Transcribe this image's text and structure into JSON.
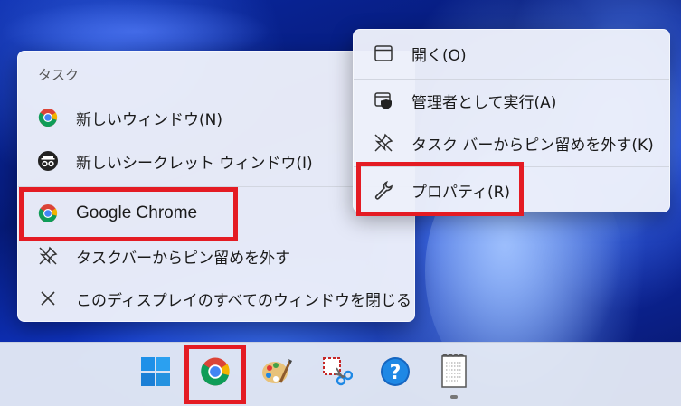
{
  "jump_list": {
    "header": "タスク",
    "items": [
      {
        "label": "新しいウィンドウ(N)",
        "icon": "chrome-icon"
      },
      {
        "label": "新しいシークレット ウィンドウ(I)",
        "icon": "incognito-icon"
      },
      {
        "label": "Google Chrome",
        "icon": "chrome-icon"
      },
      {
        "label": "タスクバーからピン留めを外す",
        "icon": "unpin-icon"
      },
      {
        "label": "このディスプレイのすべてのウィンドウを閉じる",
        "icon": "close-icon"
      }
    ]
  },
  "context_menu": {
    "items": [
      {
        "label": "開く(O)",
        "icon": "window-icon"
      },
      {
        "label": "管理者として実行(A)",
        "icon": "shield-icon"
      },
      {
        "label": "タスク バーからピン留めを外す(K)",
        "icon": "unpin-icon"
      },
      {
        "label": "プロパティ(R)",
        "icon": "wrench-icon"
      }
    ]
  },
  "taskbar": {
    "items": [
      "windows-start-icon",
      "chrome-icon",
      "paint-icon",
      "snipping-tool-icon",
      "help-icon",
      "notepad-icon"
    ]
  },
  "colors": {
    "highlight_red": "#e41b23",
    "menu_bg": "#ecf0fa",
    "taskbar_bg": "#e1e7f4"
  }
}
